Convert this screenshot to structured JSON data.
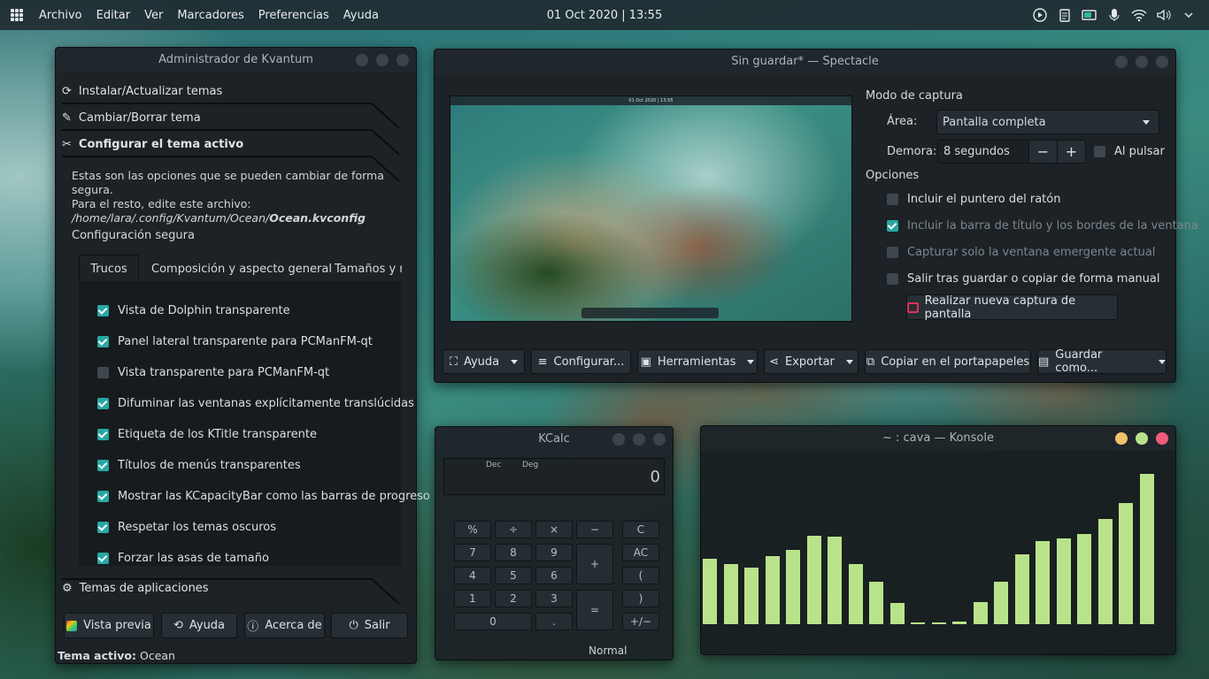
{
  "topbar": {
    "menu": [
      "Archivo",
      "Editar",
      "Ver",
      "Marcadores",
      "Preferencias",
      "Ayuda"
    ],
    "clock": "01 Oct 2020 | 13:55",
    "tray": [
      "media-play-icon",
      "clipboard-icon",
      "battery-icon",
      "microphone-icon",
      "wifi-icon",
      "volume-icon",
      "chevron-down-icon"
    ]
  },
  "kvantum": {
    "title": "Administrador de Kvantum",
    "sections": {
      "install": "Instalar/Actualizar temas",
      "change": "Cambiar/Borrar tema",
      "configure": "Configurar el tema activo",
      "apps": "Temas de aplicaciones"
    },
    "info1": "Estas son las opciones que se pueden cambiar de forma segura.",
    "info2": "Para el resto, edite este archivo:",
    "path_prefix": "/home/lara/.config/Kvantum/Ocean/",
    "path_file": "Ocean.kvconfig",
    "group": "Configuración segura",
    "tabs": [
      "Trucos",
      "Composición y aspecto general",
      "Tamaños y re"
    ],
    "options": [
      {
        "label": "Vista de Dolphin transparente",
        "checked": true
      },
      {
        "label": "Panel lateral transparente para PCManFM-qt",
        "checked": true
      },
      {
        "label": "Vista transparente para PCManFM-qt",
        "checked": false
      },
      {
        "label": "Difuminar las ventanas explícitamente translúcidas",
        "checked": true
      },
      {
        "label": "Etiqueta de los KTitle transparente",
        "checked": true
      },
      {
        "label": "Títulos de menús transparentes",
        "checked": true
      },
      {
        "label": "Mostrar las KCapacityBar como las barras de progreso",
        "checked": true
      },
      {
        "label": "Respetar los temas oscuros",
        "checked": true
      },
      {
        "label": "Forzar las asas de tamaño",
        "checked": true
      }
    ],
    "buttons": {
      "preview": "Vista previa",
      "help": "Ayuda",
      "about": "Acerca de",
      "quit": "Salir"
    },
    "status_label": "Tema activo:",
    "status_value": "Ocean"
  },
  "spectacle": {
    "title": "Sin guardar* — Spectacle",
    "mode_heading": "Modo de captura",
    "area_label": "Área:",
    "area_value": "Pantalla completa",
    "delay_label": "Demora:",
    "delay_value": "8 segundos",
    "on_click": "Al pulsar",
    "on_click_checked": false,
    "options_heading": "Opciones",
    "options": [
      {
        "label": "Incluir el puntero del ratón",
        "checked": false,
        "enabled": true
      },
      {
        "label": "Incluir la barra de título y los bordes de la ventana",
        "checked": true,
        "enabled": false
      },
      {
        "label": "Capturar solo la ventana emergente actual",
        "checked": false,
        "enabled": false
      },
      {
        "label": "Salir tras guardar o copiar de forma manual",
        "checked": false,
        "enabled": true
      }
    ],
    "new_capture": "Realizar nueva captura de pantalla",
    "toolbar": {
      "help": "Ayuda",
      "configure": "Configurar...",
      "tools": "Herramientas",
      "export": "Exportar",
      "copy": "Copiar en el portapapeles",
      "save": "Guardar como..."
    },
    "preview_caption": "01 Oct 2020 | 13:55"
  },
  "kcalc": {
    "title": "KCalc",
    "dec": "Dec",
    "deg": "Deg",
    "display": "0",
    "keys": {
      "percent": "%",
      "divide": "÷",
      "multiply": "×",
      "minus": "−",
      "clear": "C",
      "n7": "7",
      "n8": "8",
      "n9": "9",
      "plus": "+",
      "allclear": "AC",
      "n4": "4",
      "n5": "5",
      "n6": "6",
      "lparen": "(",
      "n1": "1",
      "n2": "2",
      "n3": "3",
      "equals": "=",
      "rparen": ")",
      "n0": "0",
      "dot": ".",
      "plusminus": "+/−"
    },
    "mode": "Normal"
  },
  "konsole": {
    "title": "~ : cava — Konsole"
  },
  "chart_data": {
    "type": "bar",
    "values": [
      73,
      67,
      63,
      76,
      83,
      98,
      97,
      67,
      47,
      24,
      2,
      2,
      3,
      25,
      47,
      78,
      92,
      95,
      100,
      117,
      135,
      167
    ]
  }
}
